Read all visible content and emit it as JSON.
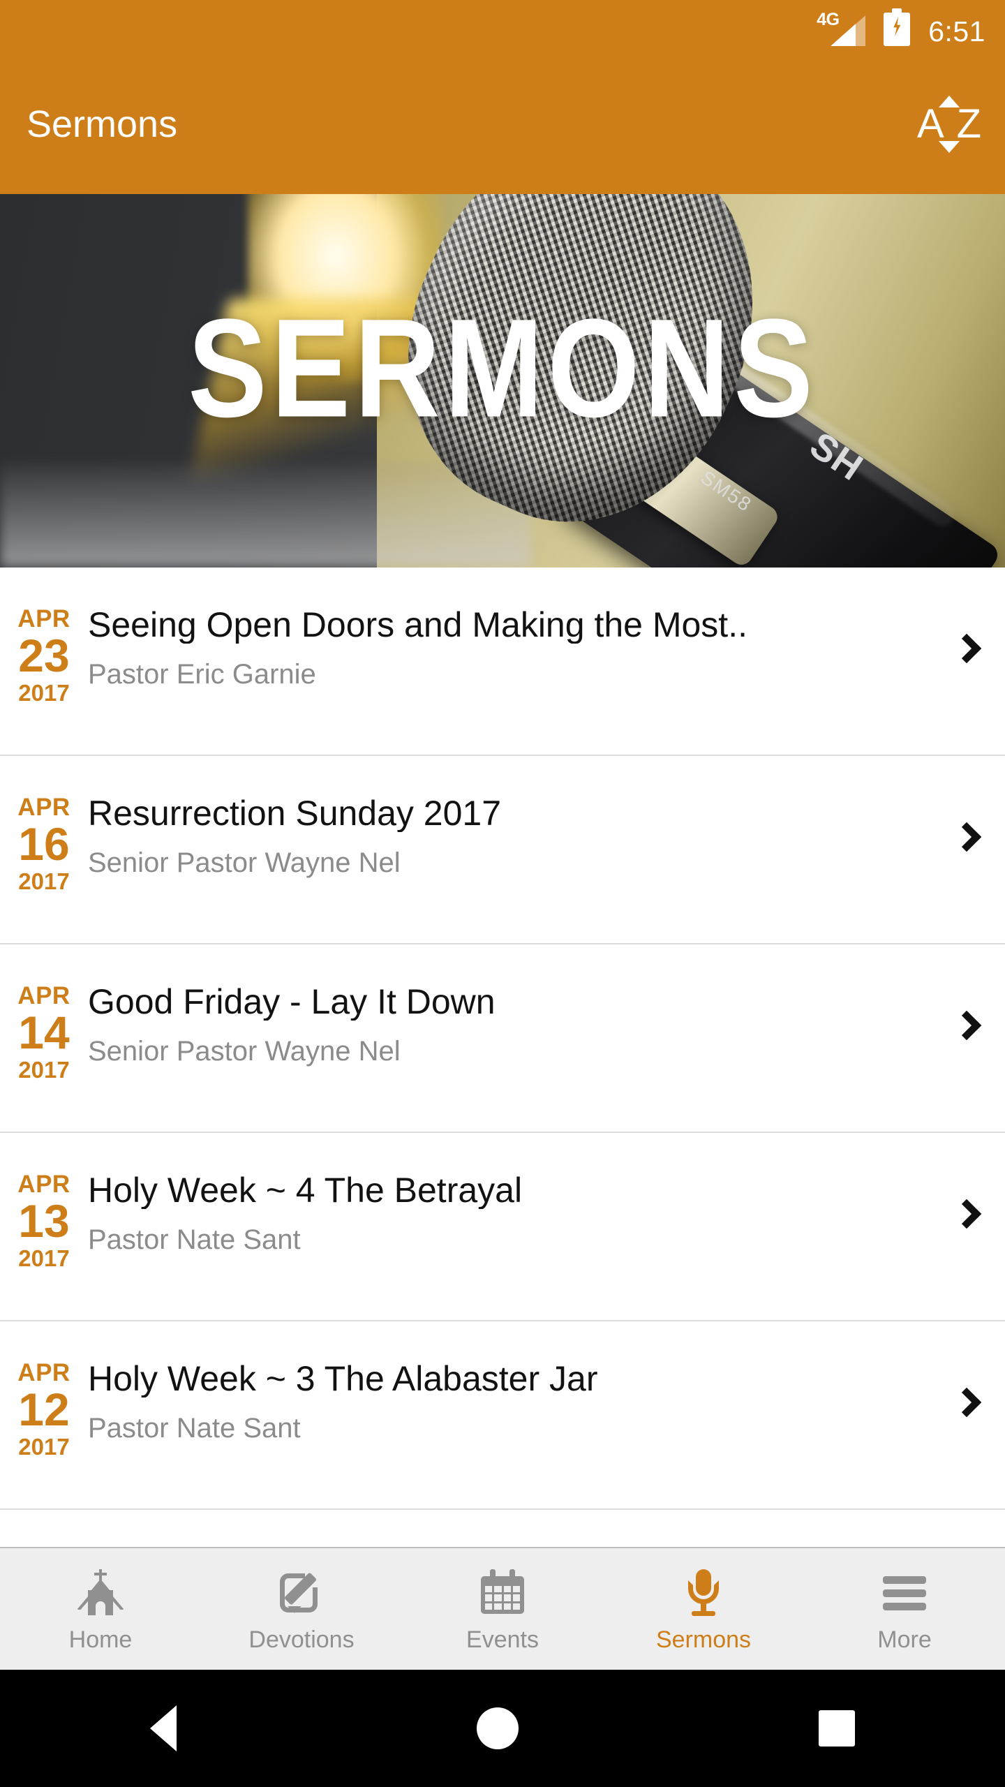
{
  "status_bar": {
    "network": "4G",
    "time": "6:51",
    "battery_icon": "battery-charging-icon",
    "signal_icon": "signal-bars-icon"
  },
  "app_bar": {
    "title": "Sermons",
    "sort_icon": "sort-alphabetical-icon",
    "sort_letter_a": "A",
    "sort_letter_z": "Z",
    "background_color": "#CE7E18"
  },
  "hero": {
    "title": "SERMONS",
    "image_alt": "microphone-banner-image",
    "mic_model_small": "SM58",
    "mic_model_large": "SH"
  },
  "sermons": [
    {
      "month": "APR",
      "day": "23",
      "year": "2017",
      "title": "Seeing Open Doors and Making the Most..",
      "speaker": "Pastor Eric Garnie"
    },
    {
      "month": "APR",
      "day": "16",
      "year": "2017",
      "title": "Resurrection Sunday 2017",
      "speaker": "Senior Pastor Wayne Nel"
    },
    {
      "month": "APR",
      "day": "14",
      "year": "2017",
      "title": "Good Friday - Lay It Down",
      "speaker": "Senior Pastor Wayne Nel"
    },
    {
      "month": "APR",
      "day": "13",
      "year": "2017",
      "title": "Holy Week ~ 4 The Betrayal",
      "speaker": "Pastor Nate Sant"
    },
    {
      "month": "APR",
      "day": "12",
      "year": "2017",
      "title": "Holy Week ~ 3 The Alabaster Jar",
      "speaker": "Pastor Nate Sant"
    }
  ],
  "tabs": [
    {
      "label": "Home",
      "icon": "church-icon",
      "active": false
    },
    {
      "label": "Devotions",
      "icon": "note-pencil-icon",
      "active": false
    },
    {
      "label": "Events",
      "icon": "calendar-icon",
      "active": false
    },
    {
      "label": "Sermons",
      "icon": "microphone-icon",
      "active": true
    },
    {
      "label": "More",
      "icon": "hamburger-menu-icon",
      "active": false
    }
  ],
  "system_nav": {
    "back": "back-triangle-icon",
    "home": "home-circle-icon",
    "recents": "recents-square-icon"
  },
  "colors": {
    "accent": "#CE7E18",
    "title_text": "#121212",
    "subtitle_text": "#8b8b8b",
    "tab_inactive": "#909090",
    "divider": "#dcdcdc"
  }
}
